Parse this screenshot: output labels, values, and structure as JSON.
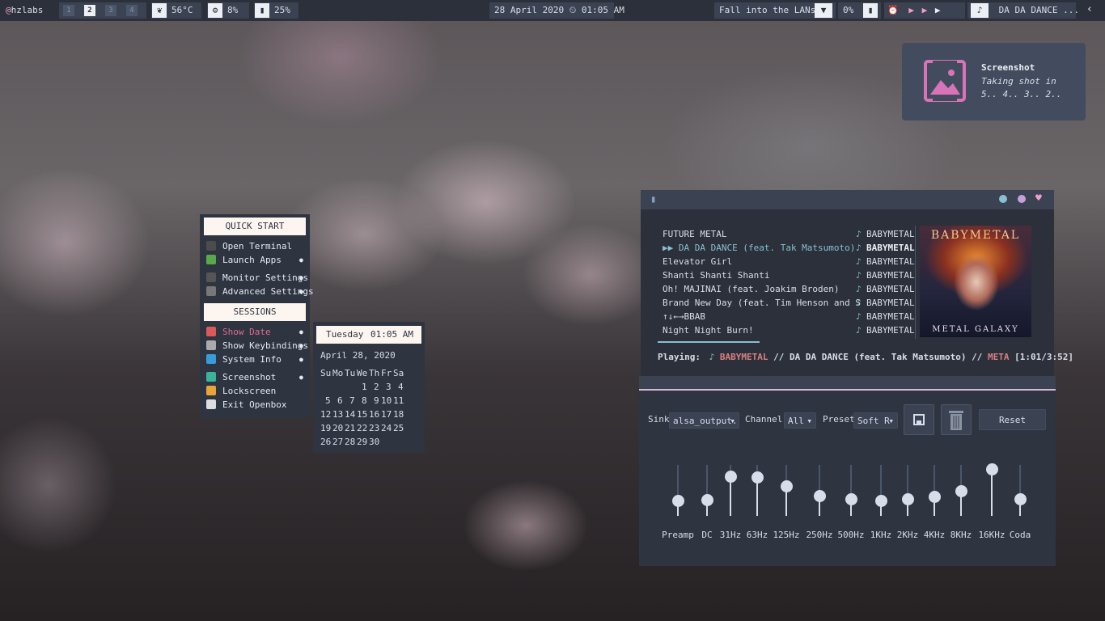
{
  "topbar": {
    "user": "hzlabs",
    "workspaces": [
      "1",
      "2",
      "3",
      "4"
    ],
    "active_workspace": 1,
    "temp": "56°C",
    "cpu": "8%",
    "mem": "25%",
    "datetime": "28 April 2020 ⏲ 01:05 AM",
    "network": "Fall into the LANs",
    "volume": "0%",
    "now_playing": "DA DA DANCE ..."
  },
  "notification": {
    "title": "Screenshot",
    "body": "Taking shot in 5.. 4.. 3.. 2.."
  },
  "menu": {
    "quick_start": "QUICK START",
    "sessions": "SESSIONS",
    "items_top": [
      {
        "label": "Open Terminal",
        "icon": "terminal-icon",
        "color": "#4c4c4c",
        "arrow": false
      },
      {
        "label": "Launch Apps",
        "icon": "rocket-icon",
        "color": "#5aa84c",
        "arrow": true
      },
      {
        "label": "Monitor Settings",
        "icon": "monitor-icon",
        "color": "#555",
        "arrow": true
      },
      {
        "label": "Advanced Settings",
        "icon": "wrench-icon",
        "color": "#777",
        "arrow": true
      }
    ],
    "items_bottom": [
      {
        "label": "Show Date",
        "icon": "calendar-icon",
        "color": "#d95a5a",
        "arrow": true,
        "highlight": true
      },
      {
        "label": "Show Keybindings",
        "icon": "keyboard-icon",
        "color": "#aaa",
        "arrow": true
      },
      {
        "label": "System Info",
        "icon": "info-icon",
        "color": "#3a9bd9",
        "arrow": true
      },
      {
        "label": "Screenshot",
        "icon": "camera-icon",
        "color": "#3ab39a",
        "arrow": true
      },
      {
        "label": "Lockscreen",
        "icon": "lock-icon",
        "color": "#e8a33a",
        "arrow": false
      },
      {
        "label": "Exit Openbox",
        "icon": "exit-icon",
        "color": "#ddd",
        "arrow": false
      }
    ]
  },
  "calendar": {
    "day": "Tuesday",
    "time": "01:05 AM",
    "date": "April 28, 2020",
    "weekdays": [
      "Su",
      "Mo",
      "Tu",
      "We",
      "Th",
      "Fr",
      "Sa"
    ],
    "weeks": [
      [
        "",
        "",
        "",
        "1",
        "2",
        "3",
        "4"
      ],
      [
        "5",
        "6",
        "7",
        "8",
        "9",
        "10",
        "11"
      ],
      [
        "12",
        "13",
        "14",
        "15",
        "16",
        "17",
        "18"
      ],
      [
        "19",
        "20",
        "21",
        "22",
        "23",
        "24",
        "25"
      ],
      [
        "26",
        "27",
        "28",
        "29",
        "30",
        "",
        ""
      ]
    ],
    "today": "28"
  },
  "player": {
    "tracks": [
      {
        "title": "FUTURE METAL",
        "artist": "BABYMETAL",
        "current": false
      },
      {
        "title": "▶▶ DA DA DANCE (feat. Tak Matsumoto)",
        "artist": "BABYMETAL",
        "current": true
      },
      {
        "title": "Elevator Girl",
        "artist": "BABYMETAL",
        "current": false
      },
      {
        "title": "Shanti Shanti Shanti",
        "artist": "BABYMETAL",
        "current": false
      },
      {
        "title": "Oh! MAJINAI (feat. Joakim Broden)",
        "artist": "BABYMETAL",
        "current": false
      },
      {
        "title": "Brand New Day (feat. Tim Henson and S",
        "artist": "BABYMETAL",
        "current": false
      },
      {
        "title": "↑↓←→BBAB",
        "artist": "BABYMETAL",
        "current": false
      },
      {
        "title": "Night Night Burn!",
        "artist": "BABYMETAL",
        "current": false
      }
    ],
    "status_label": "Playing:",
    "status_artist": "BABYMETAL",
    "status_sep1": "//",
    "status_title": "DA DA DANCE (feat. Tak Matsumoto)",
    "status_sep2": "//",
    "status_album": "META",
    "status_time": "[1:01/3:52]",
    "progress": 0.26,
    "album_title": "BABYMETAL",
    "album_subtitle": "METAL GALAXY",
    "colors": {
      "accent": "#f0a0c8",
      "teal": "#88c0d0",
      "red": "#d98080",
      "album": "#c88098"
    }
  },
  "equalizer": {
    "sink_label": "Sink",
    "sink_value": "alsa_output.",
    "channel_label": "Channel",
    "channel_value": "All",
    "preset_label": "Preset",
    "preset_value": "Soft R",
    "reset_label": "Reset",
    "bands": [
      {
        "label": "Preamp",
        "level": 0.3
      },
      {
        "label": "DC",
        "level": 0.32
      },
      {
        "label": "31Hz",
        "level": 0.77
      },
      {
        "label": "63Hz",
        "level": 0.76
      },
      {
        "label": "125Hz",
        "level": 0.58
      },
      {
        "label": "250Hz",
        "level": 0.4
      },
      {
        "label": "500Hz",
        "level": 0.33
      },
      {
        "label": "1KHz",
        "level": 0.3
      },
      {
        "label": "2KHz",
        "level": 0.33
      },
      {
        "label": "4KHz",
        "level": 0.38
      },
      {
        "label": "8KHz",
        "level": 0.5
      },
      {
        "label": "16KHz",
        "level": 0.92
      },
      {
        "label": "Coda",
        "level": 0.33
      }
    ]
  }
}
